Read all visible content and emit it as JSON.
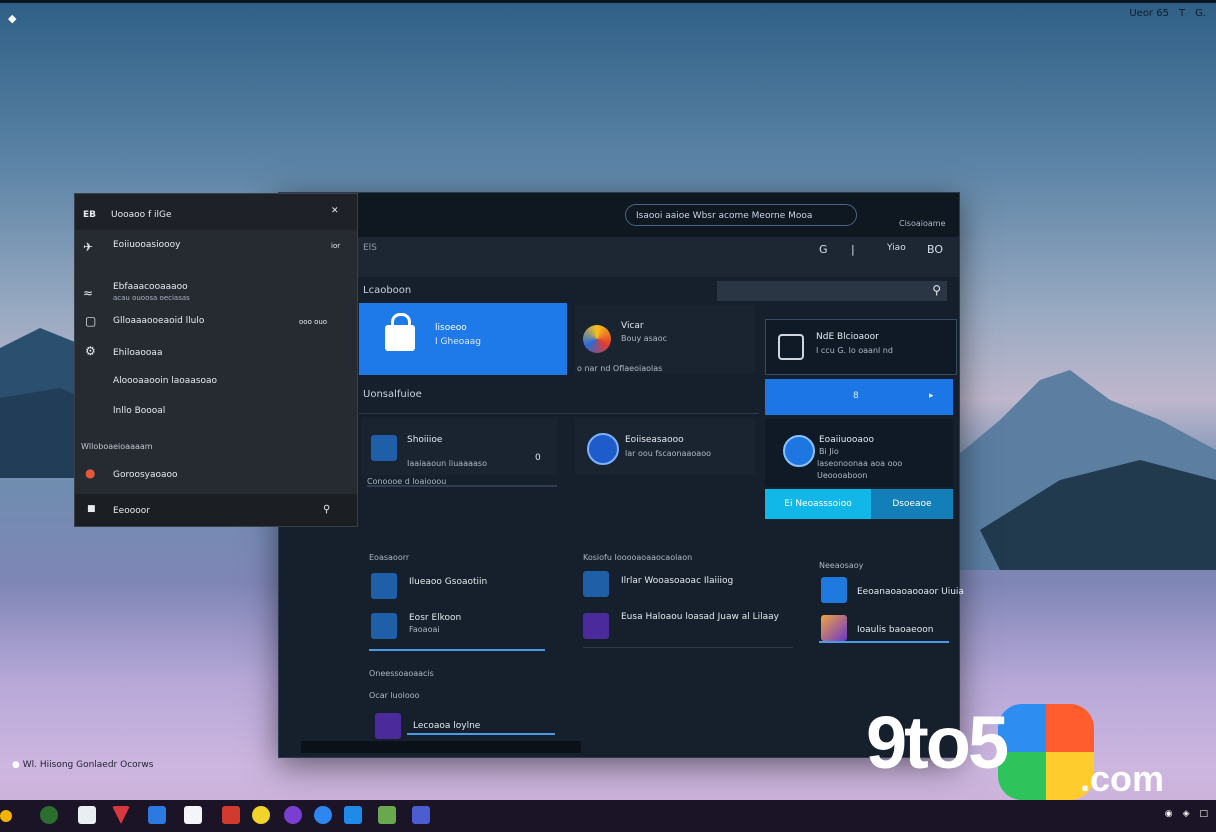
{
  "desktop": {
    "top_tray": [
      "Ueor 65",
      "T",
      "G."
    ],
    "notification": "Wl. Hiisong Gonlaedr Ocorws"
  },
  "window": {
    "search_placeholder": "Isaooi aaioe Wbsr acome Meorne Mooa",
    "sign_in": "Cisoaioame",
    "toolbar": {
      "left": "ElS",
      "icon_label": "G",
      "right1": "Yiao",
      "right2": "BO"
    },
    "section_main": "Lcaoboon",
    "tile_blue": {
      "line1": "lisoeoo",
      "line2": "I Gheoaag"
    },
    "card_vicar": {
      "title": "Vicar",
      "subtitle": "Bouy asaoc",
      "footer": "o nar nd Oflaeoiaolas"
    },
    "panel_right": {
      "title": "NdE Blcioaoor",
      "sub": "I ccu G. lo oaanl nd"
    },
    "bar_blue_label": "8",
    "section_two": "Uonsalfuioe",
    "card_a": {
      "title": "Shoiiioe",
      "sub": "Iaaiaaoun liuaaaaso",
      "badge": "0"
    },
    "card_b": {
      "title": "Eoiiseasaooo",
      "sub": "lar oou fscaonaaoaoo"
    },
    "card_c": {
      "title": "Eoaiiuooaoo",
      "sub1": "Bi Jio",
      "sub2": "laseonoonaa aoa ooo",
      "sub3": "Ueoooaboon"
    },
    "caption_a": "Conoooe d loaiooou",
    "btn_cyan": "Ei Neoasssoioo",
    "btn_cyan2": "Dsoeaoe",
    "group_left": {
      "header": "Eoasaoorr",
      "item1": "Ilueaoo Gsoaotiin",
      "item2_title": "Eosr Elkoon",
      "item2_sub": "Faoaoai"
    },
    "group_mid": {
      "header": "Kosiofu Iooooaoaaocaolaon",
      "item1": "Ilrlar Wooasoaoac Ilaiiiog",
      "item2": "Eusa Haloaou loasad Juaw al Lilaay"
    },
    "group_right": {
      "header": "Neeaosaoy",
      "item1": "Eeoanaoaoaooaor Uiuia",
      "item2": "Ioaulis baoaeoon"
    },
    "bottom_left": {
      "h1": "Oneessoaoaacis",
      "h2": "Ocar luolooo",
      "item": "Lecoaoa loylne"
    }
  },
  "menu": {
    "header": "Uooaoo f ilGe",
    "header_left": "EB",
    "items": [
      {
        "label": "Eoiiuooasioooy",
        "right": "ior"
      },
      {
        "label": "Ebfaaacooaaaoo",
        "sub": "acau ouoosa oeciasas"
      },
      {
        "label": "Glloaaaooeaoid llulo",
        "right": "ooo  ouo"
      },
      {
        "label": "Ehiloaooaa"
      },
      {
        "label": "Aloooaaooin laoaasoao"
      },
      {
        "label": "lnllo Boooal"
      }
    ],
    "section": "Wlloboaeioaaaam",
    "last_item": "Goroosyaoaoo",
    "footer": "Eeoooor"
  },
  "logo": {
    "text": "9to5",
    "suffix": ".com"
  },
  "colors": {
    "accent": "#1e7ae8",
    "cyan": "#12b7ea",
    "panel": "#15202c"
  }
}
